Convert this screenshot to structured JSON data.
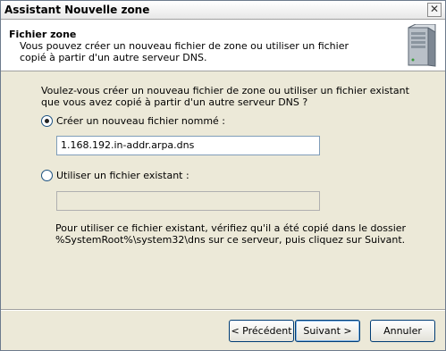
{
  "window": {
    "title": "Assistant Nouvelle zone",
    "close_glyph": "✕"
  },
  "header": {
    "title": "Fichier zone",
    "description": "Vous pouvez créer un nouveau fichier de zone ou utiliser un fichier copié à partir d'un autre serveur DNS.",
    "icon": "server-icon"
  },
  "body": {
    "question": "Voulez-vous créer un nouveau fichier de zone ou utiliser un fichier existant que vous avez copié à partir d'un autre serveur DNS ?",
    "option_new": {
      "label": "Créer un nouveau fichier nommé :",
      "selected": true,
      "value": "1.168.192.in-addr.arpa.dns"
    },
    "option_existing": {
      "label": "Utiliser un fichier existant :",
      "selected": false,
      "value": ""
    },
    "note": "Pour utiliser ce fichier existant, vérifiez qu'il a été copié dans le dossier %SystemRoot%\\system32\\dns sur ce serveur, puis cliquez sur Suivant."
  },
  "footer": {
    "back_label": "< Précédent",
    "next_label": "Suivant >",
    "cancel_label": "Annuler"
  }
}
